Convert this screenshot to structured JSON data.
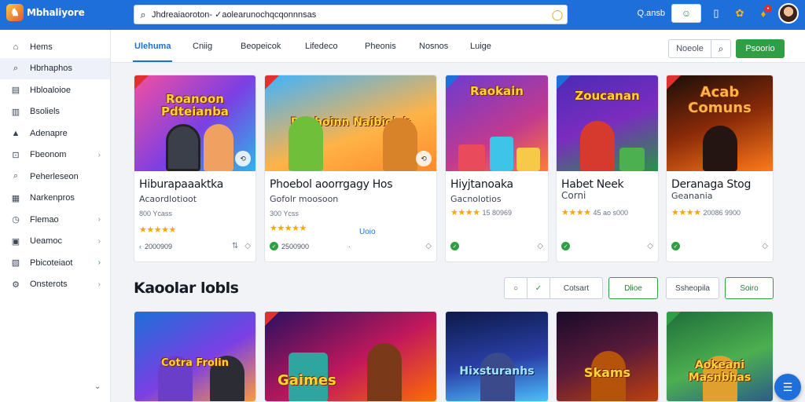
{
  "app": {
    "logo_text": "Mbhaliyore",
    "search_text": "Jhdreaiaoroton- ✓aolearunochqcqonnnsas",
    "topbar": {
      "link_label": "Q.ansb"
    }
  },
  "colors": {
    "primary": "#1e6fd9",
    "accent": "#2f9e44",
    "star": "#f2a900"
  },
  "sidebar": {
    "items": [
      {
        "label": "Hems",
        "icon": "home-icon",
        "chevron": false
      },
      {
        "label": "Hbrhaphos",
        "icon": "search-icon",
        "chevron": false
      },
      {
        "label": "Hbloaloioe",
        "icon": "list-icon",
        "chevron": false
      },
      {
        "label": "Bsoliels",
        "icon": "book-icon",
        "chevron": false
      },
      {
        "label": "Adenapre",
        "icon": "user-icon",
        "chevron": false
      },
      {
        "label": "Fbeonom",
        "icon": "grid-icon",
        "chevron": true
      },
      {
        "label": "Peherleseon",
        "icon": "search-icon",
        "chevron": false
      },
      {
        "label": "Narkenpros",
        "icon": "tag-icon",
        "chevron": false
      },
      {
        "label": "Flemao",
        "icon": "clock-icon",
        "chevron": true
      },
      {
        "label": "Ueamoc",
        "icon": "calendar-icon",
        "chevron": true
      },
      {
        "label": "Pbicoteiaot",
        "icon": "chart-icon",
        "chevron": true
      },
      {
        "label": "Onsterots",
        "icon": "settings-icon",
        "chevron": true
      }
    ]
  },
  "tabs": [
    "Ulehuma",
    "Cniig",
    "Beopeicok",
    "Lifedeco",
    "Pheonis",
    "Nosnos",
    "Luige"
  ],
  "toolbar": {
    "sort_label": "Noeole",
    "primary_label": "Psoorio"
  },
  "featured_cards": [
    {
      "title": "Hiburapaaaktka",
      "subtitle": "Acaordlotioot",
      "meta": "800 Ycass",
      "rating_count": "",
      "extra": "",
      "downloads": "2000909",
      "thumb_title": "Roanoon Pdteianba"
    },
    {
      "title": "Phoebol aoorrgagy Hos",
      "subtitle": "Gofolr moosoon",
      "meta": "300 Ycss",
      "rating_count": "",
      "extra": "Uoio",
      "downloads": "2500900",
      "thumb_title": "Raphoinn Naibiolsk"
    },
    {
      "title": "Hiyjtanoaka",
      "subtitle": "Gacnolotios",
      "meta": "",
      "rating_count": "15 80969",
      "extra": "",
      "downloads": "",
      "thumb_title": "Raokain"
    },
    {
      "title": "Habet Neek",
      "subtitle": "Corni",
      "meta": "",
      "rating_count": "45 ao s000",
      "extra": "",
      "downloads": "",
      "thumb_title": "Zoucanan"
    },
    {
      "title": "Deranaga Stog",
      "subtitle": "Geanania",
      "meta": "",
      "rating_count": "20086 9900",
      "extra": "",
      "downloads": "",
      "thumb_title": "Acab Comuns"
    }
  ],
  "section2": {
    "title": "Kaoolar lobls",
    "filters": {
      "seg_right": "Cotsart",
      "primary": "Dlioe",
      "secondary": "Ssheopila",
      "outline": "Soiro"
    }
  },
  "popular_cards": [
    {
      "thumb_title": "Cotra Frolin"
    },
    {
      "thumb_title": "Gaimes"
    },
    {
      "thumb_title": "Hixsturanhs"
    },
    {
      "thumb_title": "Skams"
    },
    {
      "thumb_title": "Aokeani Masnbhas"
    }
  ]
}
